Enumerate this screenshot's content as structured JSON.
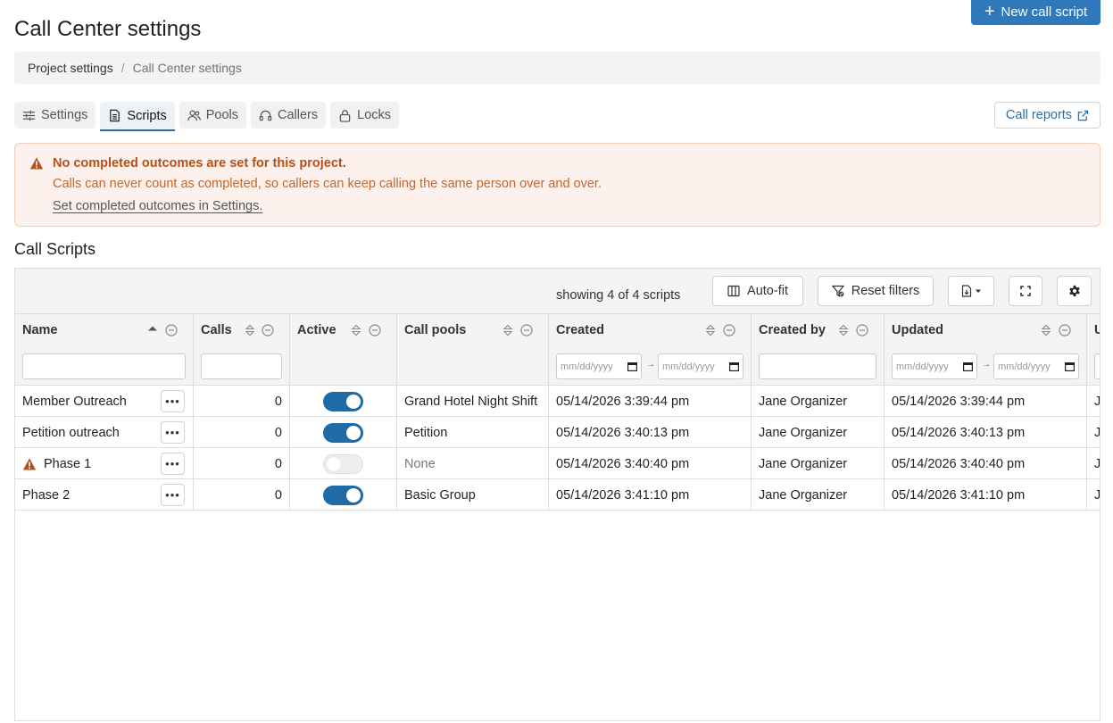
{
  "page": {
    "title": "Call Center settings",
    "new_button_label": "New call script"
  },
  "breadcrumb": {
    "parent": "Project settings",
    "separator": "/",
    "current": "Call Center settings"
  },
  "tabs": [
    {
      "label": "Settings",
      "icon": "sliders-icon",
      "active": false
    },
    {
      "label": "Scripts",
      "icon": "document-icon",
      "active": true
    },
    {
      "label": "Pools",
      "icon": "users-icon",
      "active": false
    },
    {
      "label": "Callers",
      "icon": "headset-icon",
      "active": false
    },
    {
      "label": "Locks",
      "icon": "lock-icon",
      "active": false
    }
  ],
  "call_reports_label": "Call reports",
  "alert": {
    "title": "No completed outcomes are set for this project.",
    "body": "Calls can never count as completed, so callers can keep calling the same person over and over.",
    "link": "Set completed outcomes in Settings."
  },
  "section_title": "Call Scripts",
  "toolbar": {
    "showing": "showing 4 of 4 scripts",
    "autofit": "Auto-fit",
    "reset": "Reset filters"
  },
  "columns": {
    "name": "Name",
    "calls": "Calls",
    "active": "Active",
    "pools": "Call pools",
    "created": "Created",
    "created_by": "Created by",
    "updated": "Updated",
    "next": "U"
  },
  "date_placeholder": "mm/dd/yyyy",
  "rows": [
    {
      "name": "Member Outreach",
      "calls": "0",
      "active": true,
      "pools": "Grand Hotel Night Shift",
      "created": "05/14/2026 3:39:44 pm",
      "created_by": "Jane Organizer",
      "updated": "05/14/2026 3:39:44 pm",
      "next": "J",
      "warning": false
    },
    {
      "name": "Petition outreach",
      "calls": "0",
      "active": true,
      "pools": "Petition",
      "created": "05/14/2026 3:40:13 pm",
      "created_by": "Jane Organizer",
      "updated": "05/14/2026 3:40:13 pm",
      "next": "J",
      "warning": false
    },
    {
      "name": "Phase 1",
      "calls": "0",
      "active": false,
      "pools": "None",
      "created": "05/14/2026 3:40:40 pm",
      "created_by": "Jane Organizer",
      "updated": "05/14/2026 3:40:40 pm",
      "next": "J",
      "warning": true
    },
    {
      "name": "Phase 2",
      "calls": "0",
      "active": true,
      "pools": "Basic Group",
      "created": "05/14/2026 3:41:10 pm",
      "created_by": "Jane Organizer",
      "updated": "05/14/2026 3:41:10 pm",
      "next": "J",
      "warning": false
    }
  ],
  "colors": {
    "primary": "#2f78b9",
    "alert_text": "#b5501a",
    "alert_bg": "#fcf1ec",
    "toggle_on": "#1f6ba5"
  }
}
